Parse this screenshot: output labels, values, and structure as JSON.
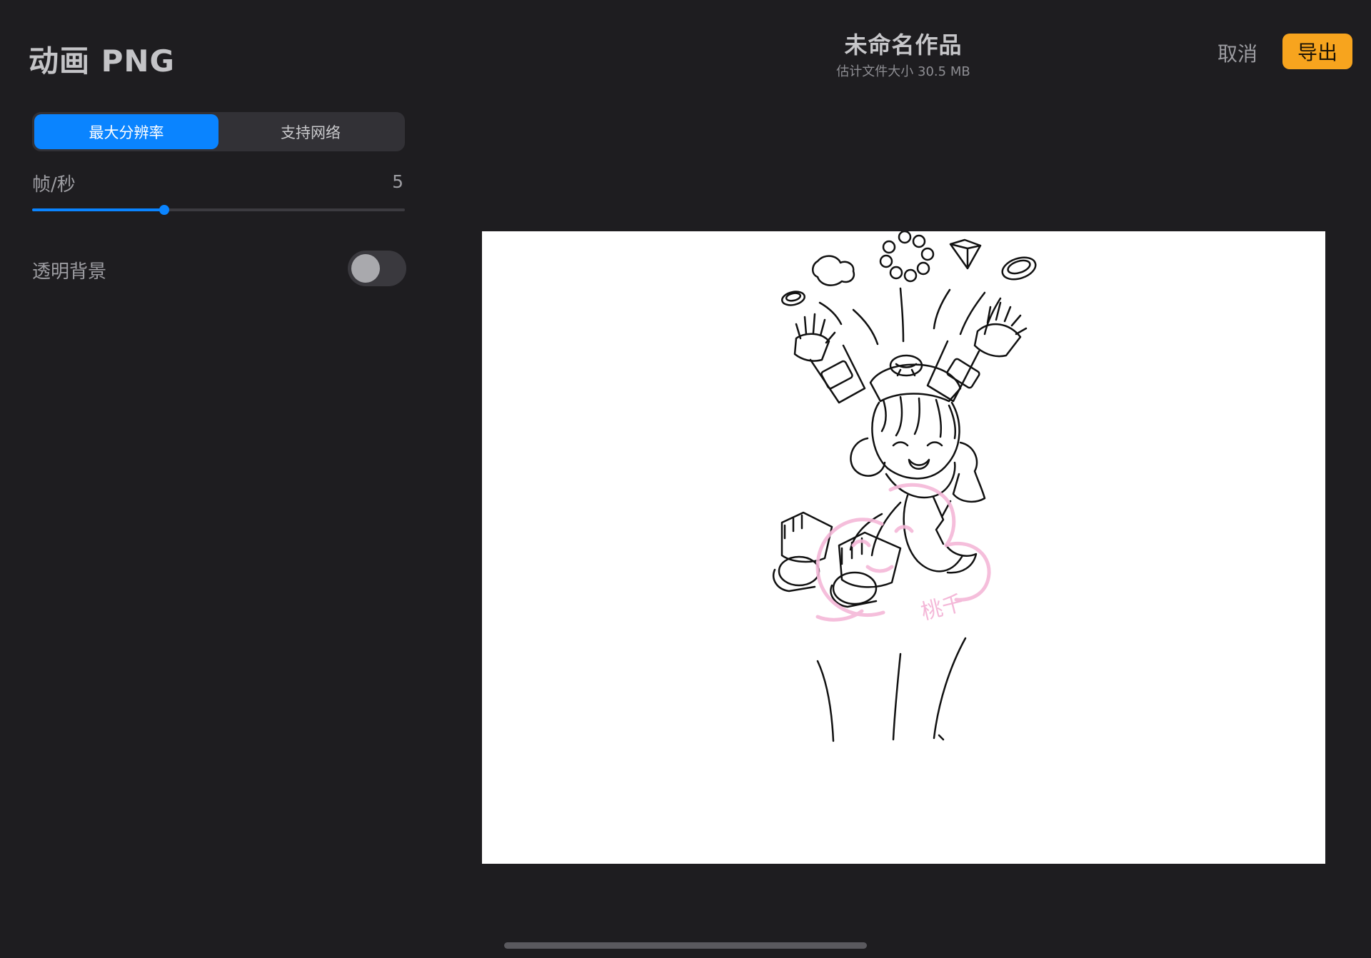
{
  "panel": {
    "title": "动画 PNG",
    "tabs": [
      {
        "label": "最大分辨率",
        "active": true
      },
      {
        "label": "支持网络",
        "active": false
      }
    ],
    "fps": {
      "label": "帧/秒",
      "value": "5",
      "fraction": 0.355
    },
    "transparent_bg": {
      "label": "透明背景",
      "on": false
    }
  },
  "header": {
    "title": "未命名作品",
    "subtitle": "估计文件大小 30.5 MB",
    "cancel_label": "取消",
    "export_label": "导出"
  },
  "artwork": {
    "watermark_text": "桃千"
  },
  "colors": {
    "accent": "#0a84ff",
    "export": "#f7a41e",
    "background": "#1e1d20",
    "watermark": "#f4b8d8"
  }
}
